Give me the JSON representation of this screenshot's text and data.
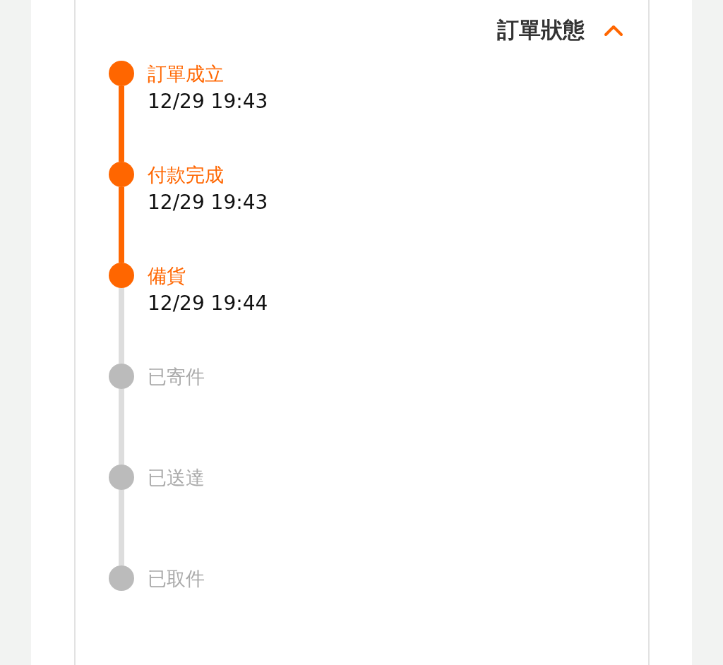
{
  "header": {
    "title": "訂單狀態",
    "expanded": true
  },
  "steps": [
    {
      "label": "訂單成立",
      "time": "12/29 19:43",
      "done": true
    },
    {
      "label": "付款完成",
      "time": "12/29 19:43",
      "done": true
    },
    {
      "label": "備貨",
      "time": "12/29 19:44",
      "done": true
    },
    {
      "label": "已寄件",
      "done": false
    },
    {
      "label": "已送達",
      "done": false
    },
    {
      "label": "已取件",
      "done": false
    }
  ]
}
